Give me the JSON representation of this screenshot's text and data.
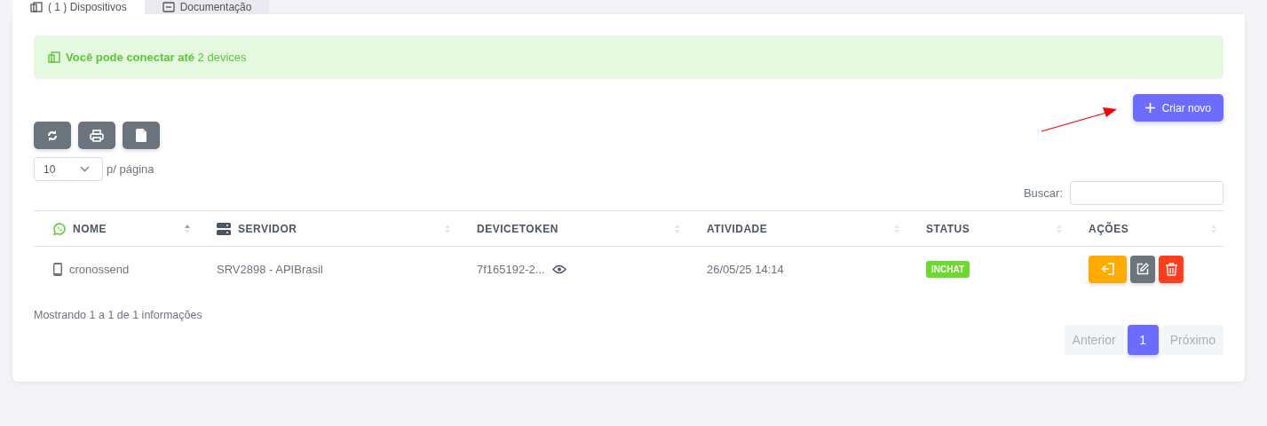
{
  "tabs": [
    {
      "label": "( 1 ) Dispositivos",
      "selected": true
    },
    {
      "label": "Documentação",
      "selected": false
    }
  ],
  "alert": {
    "text": "**Você pode conectar até** 2 devices"
  },
  "create_button": {
    "label": "Criar novo"
  },
  "page_size": {
    "value": "10",
    "suffix": "p/ página"
  },
  "search": {
    "label": "Buscar:"
  },
  "table": {
    "columns": [
      {
        "label": "NOME",
        "sorted": true
      },
      {
        "label": "SERVIDOR",
        "sorted": false
      },
      {
        "label": "DEVICETOKEN",
        "sorted": false
      },
      {
        "label": "ATIVIDADE",
        "sorted": false
      },
      {
        "label": "STATUS",
        "sorted": false
      },
      {
        "label": "AÇÕES",
        "sorted": false
      }
    ],
    "rows": [
      {
        "nome": "cronossend",
        "servidor": "SRV2898 - APIBrasil",
        "devicetoken": "7f165192-2...",
        "atividade": "26/05/25 14:14",
        "status": "INCHAT"
      }
    ]
  },
  "info": "Mostrando 1 a 1 de 1 informações",
  "pagination": [
    {
      "label": "Anterior",
      "selected": false
    },
    {
      "label": "1",
      "selected": true
    },
    {
      "label": "Próximo",
      "selected": false
    }
  ]
}
